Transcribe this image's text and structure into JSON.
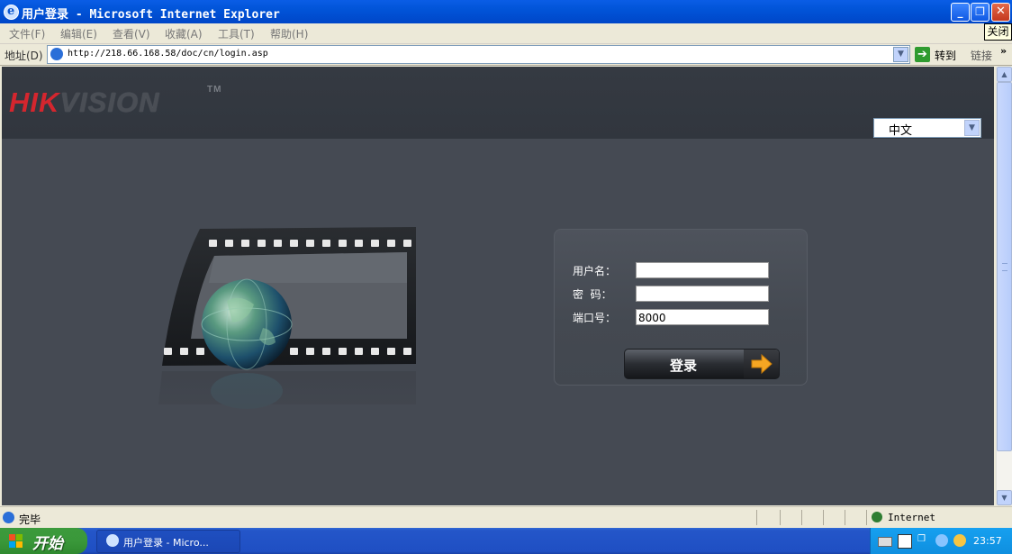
{
  "window": {
    "title": "用户登录 - Microsoft Internet Explorer",
    "tooltip": "关闭"
  },
  "menu": {
    "items": [
      "文件(F)",
      "编辑(E)",
      "查看(V)",
      "收藏(A)",
      "工具(T)",
      "帮助(H)"
    ]
  },
  "address": {
    "label": "地址(D)",
    "url": "http://218.66.168.58/doc/cn/login.asp",
    "go_label": "转到",
    "links_label": "链接"
  },
  "page": {
    "logo": {
      "red": "HIK",
      "gray": "VISION",
      "tm": "TM"
    },
    "language": "中文",
    "login": {
      "username_label": "用户名：",
      "password_label": "密  码：",
      "port_label": "端口号：",
      "username_value": "",
      "password_value": "",
      "port_value": "8000",
      "button_label": "登录"
    }
  },
  "status": {
    "text": "完毕",
    "zone": "Internet"
  },
  "taskbar": {
    "start_label": "开始",
    "task_title": "用户登录 - Micro...",
    "clock": "23:57"
  },
  "colors": {
    "page_bg": "#454a53",
    "header_bg": "#33383f",
    "brand_red": "#d4262e",
    "accent_orange": "#f5a623"
  }
}
